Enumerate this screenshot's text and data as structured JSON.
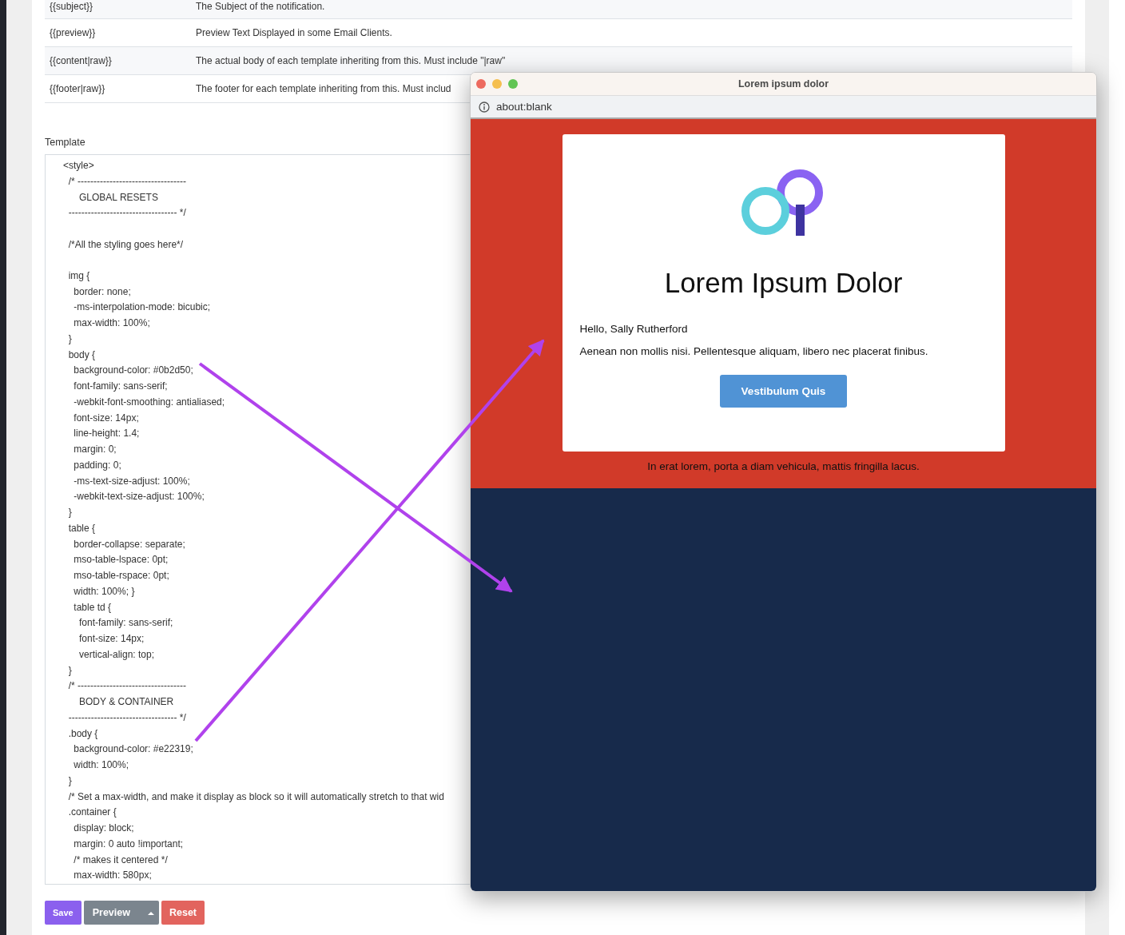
{
  "variables": [
    {
      "name": "{{subject}}",
      "description": "The Subject of the notification."
    },
    {
      "name": "{{preview}}",
      "description": "Preview Text Displayed in some Email Clients."
    },
    {
      "name": "{{content|raw}}",
      "description": "The actual body of each template inheriting from this. Must include \"|raw\""
    },
    {
      "name": "{{footer|raw}}",
      "description": "The footer for each template inheriting from this. Must includ"
    }
  ],
  "template": {
    "label": "Template",
    "blocks": [
      [
        "<style>",
        "  /* ----------------------------------",
        "      GLOBAL RESETS",
        "  ---------------------------------- */"
      ],
      [
        "  /*All the styling goes here*/"
      ],
      [
        "  img {",
        "    border: none;",
        "    -ms-interpolation-mode: bicubic;",
        "    max-width: 100%;",
        "  }",
        "  body {",
        "    background-color: #0b2d50;",
        "    font-family: sans-serif;",
        "    -webkit-font-smoothing: antialiased;",
        "    font-size: 14px;",
        "    line-height: 1.4;",
        "    margin: 0;",
        "    padding: 0;",
        "    -ms-text-size-adjust: 100%;",
        "    -webkit-text-size-adjust: 100%;",
        "  }",
        "  table {",
        "    border-collapse: separate;",
        "    mso-table-lspace: 0pt;",
        "    mso-table-rspace: 0pt;",
        "    width: 100%; }",
        "    table td {",
        "      font-family: sans-serif;",
        "      font-size: 14px;",
        "      vertical-align: top;",
        "  }",
        "  /* ----------------------------------",
        "      BODY & CONTAINER",
        "  ---------------------------------- */",
        "  .body {",
        "    background-color: #e22319;",
        "    width: 100%;",
        "  }",
        "  /* Set a max-width, and make it display as block so it will automatically stretch to that wid",
        "  .container {",
        "    display: block;",
        "    margin: 0 auto !important;",
        "    /* makes it centered */",
        "    max-width: 580px;"
      ]
    ]
  },
  "buttons": [
    {
      "kind": "save",
      "label": "Save"
    },
    {
      "kind": "split",
      "label": "Preview"
    },
    {
      "kind": "reset",
      "label": "Reset"
    }
  ],
  "preview_window": {
    "title": "Lorem ipsum dolor",
    "address": "about:blank",
    "email": {
      "heading": "Lorem Ipsum Dolor",
      "greeting": "Hello, Sally Rutherford",
      "body": "Aenean non mollis nisi. Pellentesque aliquam, libero nec placerat finibus.",
      "button": "Vestibulum Quis",
      "footer": "In erat lorem, porta a diam vehicula, mattis fringilla lacus."
    }
  }
}
